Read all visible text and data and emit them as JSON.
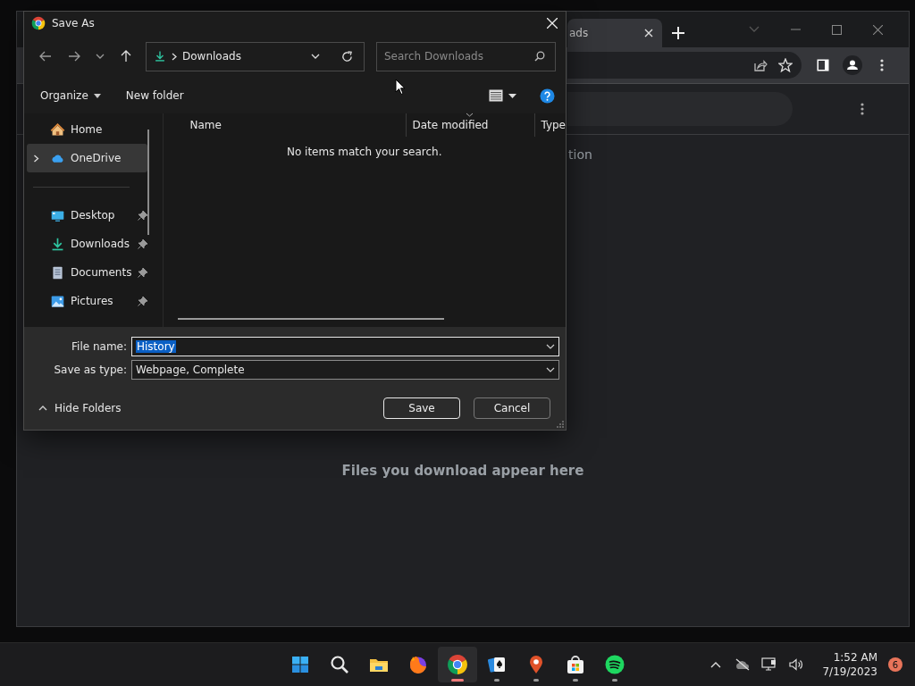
{
  "browser": {
    "tab": {
      "label": "ads"
    },
    "page_fragment": "tion",
    "empty_message": "Files you download appear here"
  },
  "dialog": {
    "title": "Save As",
    "location": "Downloads",
    "search": {
      "placeholder": "Search Downloads"
    },
    "toolbar": {
      "organize": "Organize",
      "new_folder": "New folder"
    },
    "nav_sections": [
      [
        {
          "label": "Home",
          "selected": false
        },
        {
          "label": "OneDrive",
          "selected": true,
          "expanded": false
        }
      ],
      [
        {
          "label": "Desktop",
          "selected": false,
          "pinned": true
        },
        {
          "label": "Downloads",
          "selected": false,
          "pinned": true
        },
        {
          "label": "Documents",
          "selected": false,
          "pinned": true
        },
        {
          "label": "Pictures",
          "selected": false,
          "pinned": true
        }
      ]
    ],
    "columns": [
      {
        "label": "Name",
        "sorted": false
      },
      {
        "label": "Date modified",
        "sorted": true
      },
      {
        "label": "Type",
        "sorted": false
      }
    ],
    "empty_message": "No items match your search.",
    "file_name": {
      "label": "File name:",
      "value": "History",
      "selected": true
    },
    "save_as_type": {
      "label": "Save as type:",
      "value": "Webpage, Complete"
    },
    "hide_folders": "Hide Folders",
    "buttons": [
      {
        "label": "Save",
        "default": true
      },
      {
        "label": "Cancel",
        "default": false
      }
    ]
  },
  "taskbar": {
    "apps": [
      {
        "active": false,
        "running": false
      },
      {
        "active": false,
        "running": false
      },
      {
        "active": false,
        "running": false
      },
      {
        "active": false,
        "running": false
      },
      {
        "active": true,
        "running": true
      },
      {
        "active": false,
        "running": true
      },
      {
        "active": false,
        "running": true
      },
      {
        "active": false,
        "running": true
      },
      {
        "active": false,
        "running": true
      }
    ],
    "tray": {
      "time": "1:52 AM",
      "date": "7/19/2023",
      "notifications": "6"
    }
  }
}
